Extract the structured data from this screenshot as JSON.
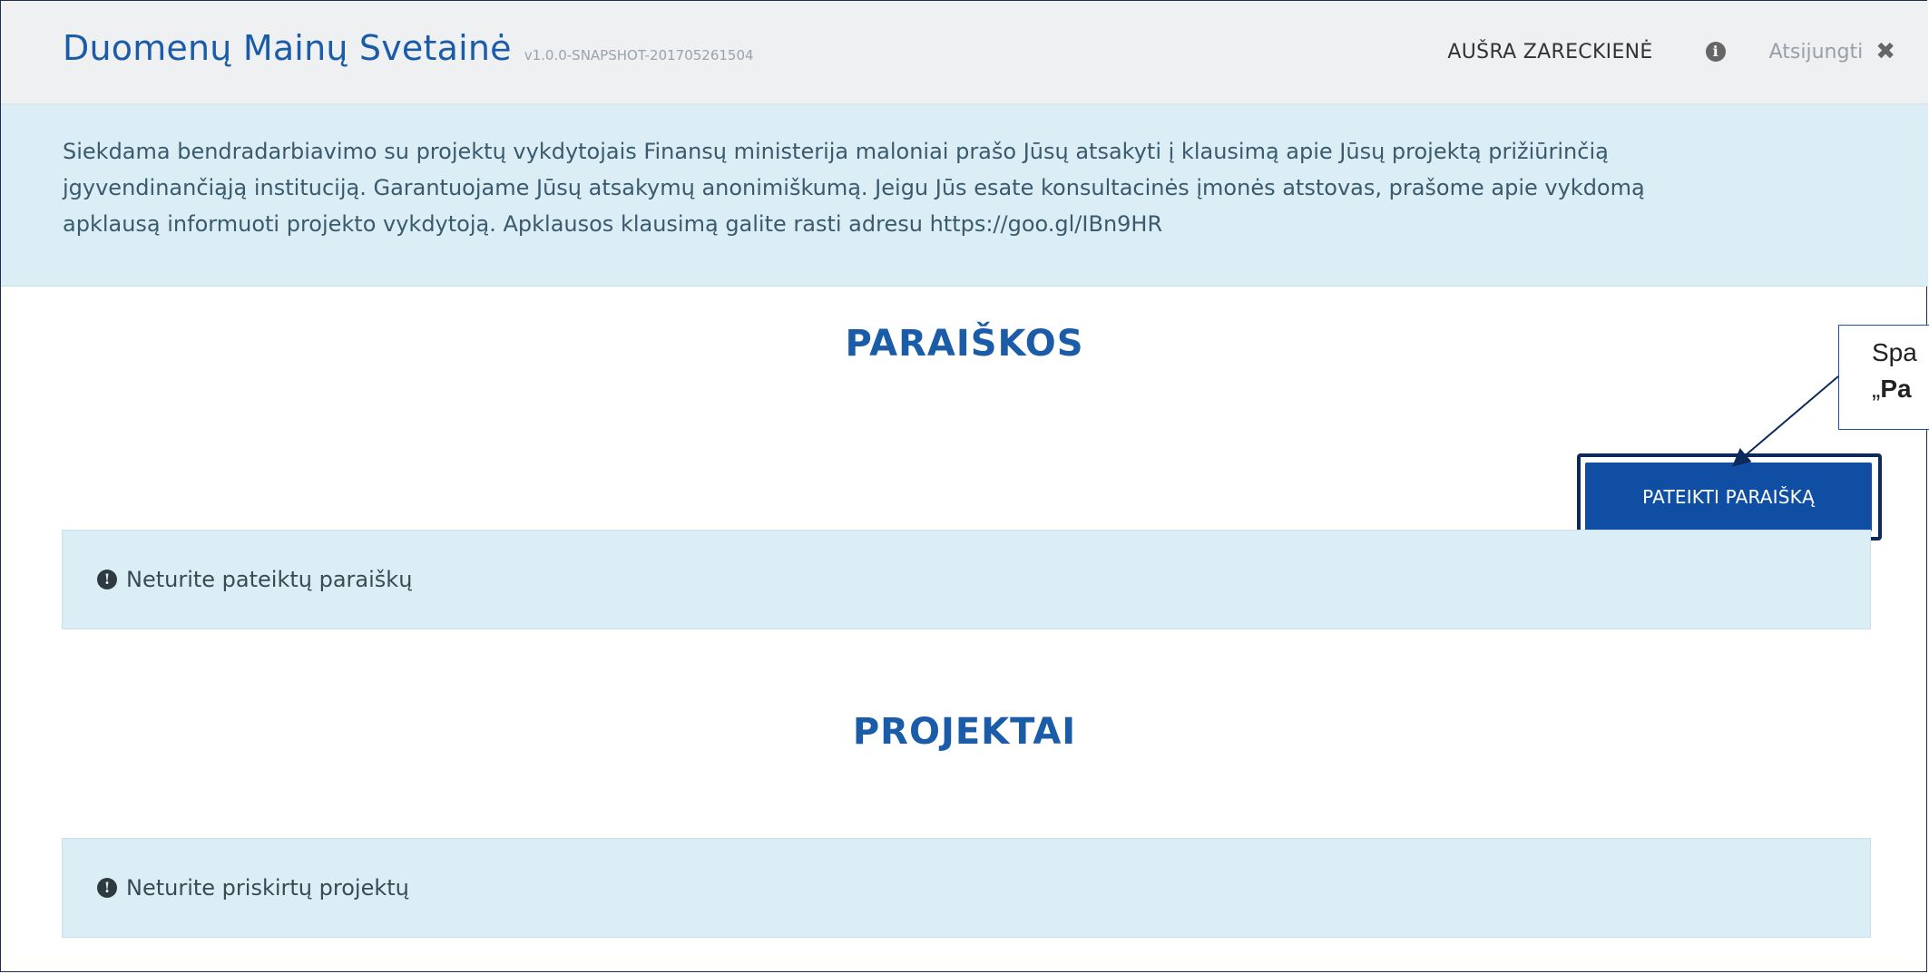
{
  "header": {
    "title": "Duomenų Mainų Svetainė",
    "version": "v1.0.0-SNAPSHOT-201705261504",
    "user_name": "AUŠRA ZARECKIENĖ",
    "info_icon": "info-circle-icon",
    "logout_label": "Atsijungti",
    "logout_icon": "close-icon"
  },
  "notice": {
    "text": "Siekdama bendradarbiavimo su projektų vykdytojais Finansų ministerija maloniai prašo Jūsų atsakyti į klausimą apie Jūsų projektą prižiūrinčią\njgyvendinančiąją instituciją. Garantuojame Jūsų atsakymų anonimiškumą. Jeigu Jūs esate konsultacinės įmonės atstovas, prašome apie vykdomą\napklausą informuoti projekto vykdytoją. Apklausos klausimą galite rasti adresu https://goo.gl/IBn9HR"
  },
  "applications": {
    "title": "PARAIŠKOS",
    "submit_button": "PATEIKTI PARAIŠKĄ",
    "empty_message": "Neturite pateiktų paraiškų"
  },
  "projects": {
    "title": "PROJEKTAI",
    "empty_message": "Neturite priskirtų projektų"
  },
  "callout": {
    "line1": "Spa",
    "line2_prefix": "„",
    "line2_bold": "Pa"
  },
  "colors": {
    "brand_blue": "#1b5ca8",
    "button_blue": "#0f4ea3",
    "info_bg": "#dbeef6",
    "header_bg": "#eef0f1"
  }
}
